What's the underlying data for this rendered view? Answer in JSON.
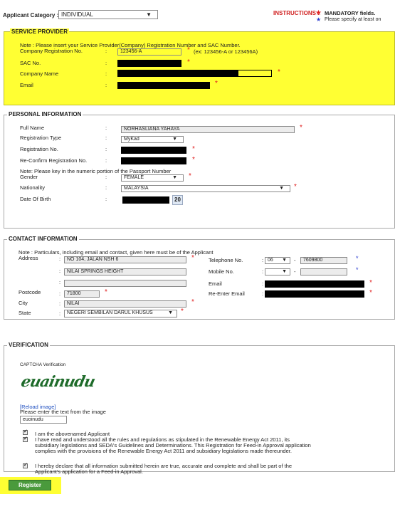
{
  "header": {
    "category_label": "Applicant Category :",
    "category_value": "INDIVIDUAL",
    "instructions_label": "INSTRUCTIONS :",
    "mandatory_text": "MANDATORY fields.",
    "specify_text": "Please specify at least on"
  },
  "service_provider": {
    "legend": "SERVICE PROVIDER",
    "note": "Note : Please insert your Service Provider(Company) Registration Number and SAC Number.",
    "reg_label": "Company Registration No.",
    "reg_value": "123456-A",
    "reg_hint": "(ex: 123456-A or 123456A)",
    "sac_label": "SAC No.",
    "company_label": "Company Name",
    "email_label": "Email"
  },
  "personal": {
    "legend": "PERSONAL INFORMATION",
    "fullname_label": "Full Name",
    "fullname_value": "NORHASLIANA YAHAYA",
    "regtype_label": "Registration Type",
    "regtype_value": "MyKad",
    "regno_label": "Registration No.",
    "reconfirm_label": "Re-Confirm Registration No.",
    "note": "Note: Please key in the numeric portion of the Passport Number",
    "gender_label": "Gender",
    "gender_value": "FEMALE",
    "nationality_label": "Nationality",
    "nationality_value": "MALAYSIA",
    "dob_label": "Date Of Birth",
    "dob_suffix": "20"
  },
  "contact": {
    "legend": "CONTACT INFORMATION",
    "note": "Note : Particulars, including email and contact, given here must be of the Applicant",
    "address_label": "Address",
    "address1": "NO 104, JALAN NSH 6",
    "address2": "NILAI SPRINGS HEIGHT",
    "address3": "",
    "postcode_label": "Postcode",
    "postcode_value": "71800",
    "city_label": "City",
    "city_value": "NILAI",
    "state_label": "State",
    "state_value": "NEGERI SEMBILAN DARUL KHUSUS",
    "tel_label": "Telephone No.",
    "tel_prefix": "06",
    "tel_value": "7609800",
    "mobile_label": "Mobile No.",
    "mobile_prefix": "",
    "email_label": "Email",
    "reemail_label": "Re-Enter Email"
  },
  "verification": {
    "legend": "VERIFICATION",
    "captcha_label": "CAPTCHA Verification",
    "captcha_image_text": "euainudu",
    "reload_label": "[Reload image]",
    "enter_text_label": "Please enter the text from the image",
    "captcha_input": "euoinudu",
    "decl1": "I am the abovenamed Applicant",
    "decl2": "I have read and understood all the rules and regulations as stipulated in the Renewable Energy Act 2011, its subsidiary legislations and SEDA's Guidelines and Determinations. This Registration for Feed-in Approval application complies with the provisions of the Renewable Energy Act 2011 and subsidiary legislations made thereunder.",
    "decl3": "I hereby declare that all information submitted herein are true, accurate and complete and shall be part of the Applicant's application for a Feed-in Approval."
  },
  "register_label": "Register",
  "colors": {
    "highlight": "#ffff33",
    "required_star": "#e02020",
    "register_bg": "#4a9a3c"
  }
}
